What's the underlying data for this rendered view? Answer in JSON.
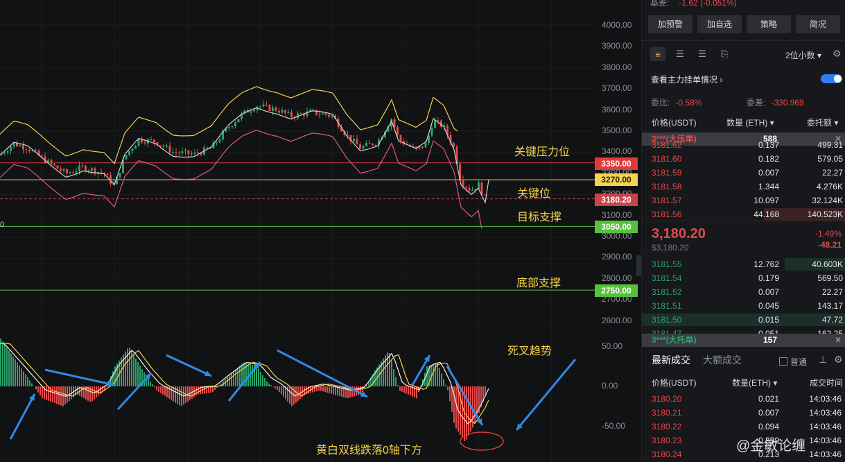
{
  "chart": {
    "price_axis": [
      "4000.00",
      "3900.00",
      "3800.00",
      "3700.00",
      "3600.00",
      "3500.00",
      "3400.00",
      "3300.00",
      "3200.00",
      "3100.00",
      "3000.00",
      "2900.00",
      "2800.00",
      "2700.00",
      "2600.00"
    ],
    "macd_axis": [
      "50.00",
      "0.00",
      "-50.00"
    ],
    "levels": [
      {
        "label": "3350.00",
        "bg": "#e03a3a",
        "fg": "#ffffff"
      },
      {
        "label": "3270.00",
        "bg": "#f5d34a",
        "fg": "#222222"
      },
      {
        "label": "3180.20",
        "bg": "#c8454a",
        "fg": "#ffffff"
      },
      {
        "label": "3050.00",
        "bg": "#57c13c",
        "fg": "#ffffff"
      },
      {
        "label": "2750.00",
        "bg": "#57c13c",
        "fg": "#ffffff"
      }
    ],
    "annotations": {
      "key_resistance": "关键压力位",
      "key_level": "关键位",
      "target_support": "目标支撑",
      "bottom_support": "底部支撑",
      "death_cross": "死叉趋势",
      "lines_below_zero": "黄白双线跌落0轴下方"
    },
    "left_cut_label": "0",
    "colors": {
      "up": "#2aa26b",
      "down": "#e04b4b",
      "boll_upper": "#f5d34a",
      "boll_lower": "#e0578a",
      "ma": "#cfcfcf",
      "arrow": "#2f8ae6"
    }
  },
  "panel": {
    "basis_label": "基差:",
    "basis_value": "-1.62 (-0.051%)",
    "buttons": [
      "加预警",
      "加自选",
      "策略",
      "简况"
    ],
    "decimals": "2位小数 ▾",
    "main_force": "查看主力挂单情况 ›",
    "commission_ratio_label": "委比:",
    "commission_ratio": "-0.58%",
    "commission_diff_label": "委差:",
    "commission_diff": "-330.969",
    "ob_header": {
      "price": "价格(USDT)",
      "qty": "数量 (ETH) ▾",
      "total": "委托额 ▾"
    },
    "big_ask": {
      "name": "3***(大压单)",
      "qty": "588"
    },
    "asks": [
      {
        "p": "3181.62",
        "q": "0.137",
        "t": "499.31",
        "d": 0
      },
      {
        "p": "3181.60",
        "q": "0.182",
        "t": "579.05",
        "d": 0
      },
      {
        "p": "3181.59",
        "q": "0.007",
        "t": "22.27",
        "d": 0
      },
      {
        "p": "3181.58",
        "q": "1.344",
        "t": "4.276K",
        "d": 0
      },
      {
        "p": "3181.57",
        "q": "10.097",
        "t": "32.124K",
        "d": 0
      },
      {
        "p": "3181.56",
        "q": "44.168",
        "t": "140.523K",
        "d": 0.4
      }
    ],
    "last_price": "3,180.20",
    "last_usd": "$3,180.20",
    "change_pct": "-1.49%",
    "change_abs": "-48.21",
    "bids": [
      {
        "p": "3181.55",
        "q": "12.762",
        "t": "40.603K",
        "d": 0.3
      },
      {
        "p": "3181.54",
        "q": "0.179",
        "t": "569.50",
        "d": 0
      },
      {
        "p": "3181.52",
        "q": "0.007",
        "t": "22.27",
        "d": 0
      },
      {
        "p": "3181.51",
        "q": "0.045",
        "t": "143.17",
        "d": 0
      },
      {
        "p": "3181.50",
        "q": "0.015",
        "t": "47.72",
        "d": 1
      },
      {
        "p": "3181.47",
        "q": "0.051",
        "t": "162.25",
        "d": 0
      }
    ],
    "big_bid": {
      "name": "3***(大托单)",
      "qty": "157"
    },
    "tabs": [
      "最新成交",
      "大额成交"
    ],
    "normal_label": "普通",
    "trade_header": {
      "price": "价格(USDT)",
      "qty": "数量(ETH) ▾",
      "time": "成交时间"
    },
    "trades": [
      {
        "p": "3180.20",
        "q": "0.021",
        "t": "14:03:46"
      },
      {
        "p": "3180.21",
        "q": "0.007",
        "t": "14:03:46"
      },
      {
        "p": "3180.22",
        "q": "0.094",
        "t": "14:03:46"
      },
      {
        "p": "3180.23",
        "q": "0.359",
        "t": "14:03:46"
      },
      {
        "p": "3180.24",
        "q": "0.213",
        "t": "14:03:46"
      }
    ]
  },
  "watermark": "@金敏论缠"
}
